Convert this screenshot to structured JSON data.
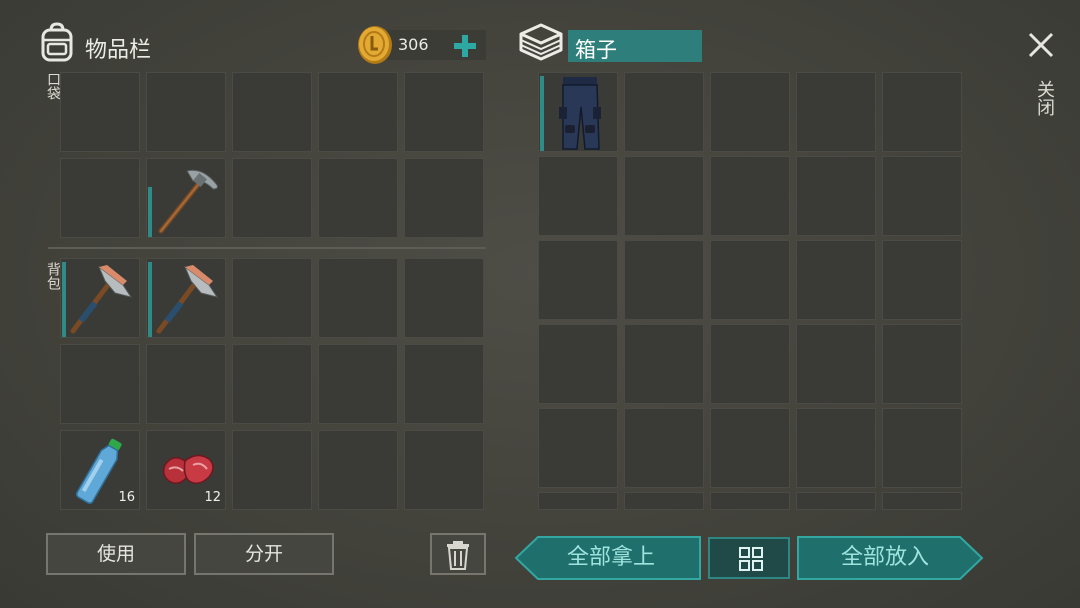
{
  "inventory": {
    "title": "物品栏",
    "coins": "306",
    "pocket_label": "口袋",
    "backpack_label": "背包",
    "items": [
      {
        "name": "pickaxe",
        "slot": "pocket-row2-col2",
        "durability_fraction": 0.65
      },
      {
        "name": "hatchet",
        "slot": "backpack-row1-col1",
        "durability_fraction": 0.95
      },
      {
        "name": "hatchet",
        "slot": "backpack-row1-col2",
        "durability_fraction": 0.95
      },
      {
        "name": "water-bottle",
        "slot": "backpack-row3-col1",
        "quantity": "16"
      },
      {
        "name": "raw-meat",
        "slot": "backpack-row3-col2",
        "quantity": "12"
      }
    ],
    "use_button": "使用",
    "split_button": "分开"
  },
  "box": {
    "title": "箱子",
    "items": [
      {
        "name": "pants",
        "slot": "row1-col1",
        "durability_fraction": 0.95
      }
    ],
    "take_all_button": "全部拿上",
    "put_all_button": "全部放入"
  },
  "close_label": "关闭",
  "colors": {
    "background": "#43433c",
    "slot": "#3a3b36",
    "accent_teal": "#2f8a88",
    "button_teal": "#1f6f6d",
    "coin_gold": "#d9a12b"
  }
}
